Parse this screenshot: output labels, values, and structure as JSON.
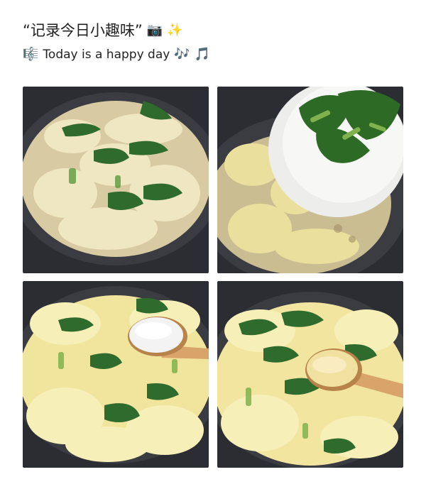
{
  "post": {
    "title": "“记录今日小趣味”",
    "title_emojis": [
      "camera-icon",
      "sparkles-icon"
    ],
    "subtitle_icon": "music-score-icon",
    "subtitle": "Today is a happy day",
    "subtitle_emojis": [
      "music-notes-icon",
      "music-note-icon"
    ]
  },
  "photos": [
    {
      "name": "photo-egg-drop-soup-with-greens"
    },
    {
      "name": "photo-adding-spinach-to-pot"
    },
    {
      "name": "photo-adding-salt-spoon"
    },
    {
      "name": "photo-adding-seasoning-spoon"
    }
  ],
  "colors": {
    "pan": "#2b2d33",
    "egg": "#efe6bf",
    "broth": "#d8caa2",
    "greens": "#2f6b2c",
    "spoon": "#d9a469"
  }
}
